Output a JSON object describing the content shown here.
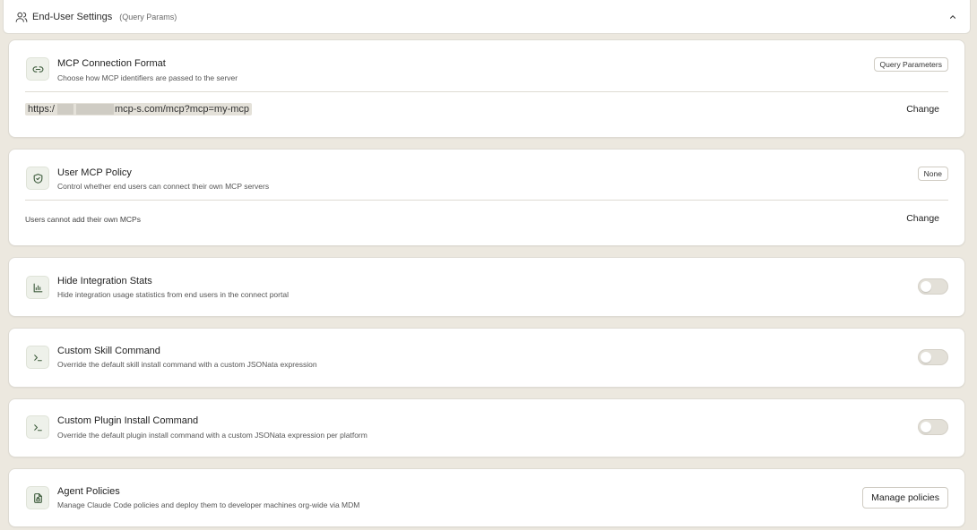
{
  "header": {
    "title": "End-User Settings",
    "subtitle": "(Query Params)",
    "icon": "users-icon",
    "collapse_icon": "chevron-up-icon"
  },
  "cards": {
    "connection": {
      "icon": "link-icon",
      "title": "MCP Connection Format",
      "description": "Choose how MCP identifiers are passed to the server",
      "badge": "Query Parameters",
      "url_prefix": "https:/",
      "url_suffix": "mcp-s.com/mcp?mcp=my-mcp",
      "change_label": "Change"
    },
    "policy": {
      "icon": "shield-check-icon",
      "title": "User MCP Policy",
      "description": "Control whether end users can connect their own MCP servers",
      "badge": "None",
      "status_text": "Users cannot add their own MCPs",
      "change_label": "Change"
    },
    "stats": {
      "icon": "bar-chart-icon",
      "title": "Hide Integration Stats",
      "description": "Hide integration usage statistics from end users in the connect portal",
      "enabled": false
    },
    "skill": {
      "icon": "terminal-icon",
      "title": "Custom Skill Command",
      "description": "Override the default skill install command with a custom JSONata expression",
      "enabled": false
    },
    "plugin": {
      "icon": "terminal-icon",
      "title": "Custom Plugin Install Command",
      "description": "Override the default plugin install command with a custom JSONata expression per platform",
      "enabled": false
    },
    "agent": {
      "icon": "file-lock-icon",
      "title": "Agent Policies",
      "description": "Manage Claude Code policies and deploy them to developer machines org-wide via MDM",
      "button_label": "Manage policies"
    }
  },
  "colors": {
    "page_bg": "#ece8df",
    "card_bg": "#ffffff",
    "icon_stroke": "#3b5a3a",
    "toggle_off": "#e3e0d8"
  }
}
